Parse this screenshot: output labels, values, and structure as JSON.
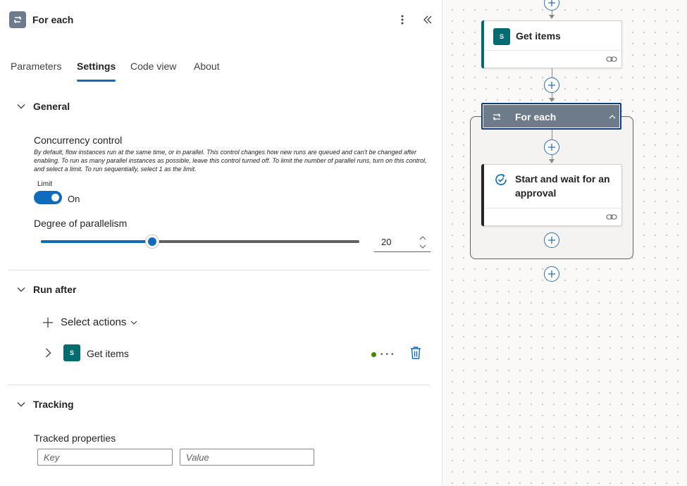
{
  "panel": {
    "title": "For each",
    "tabs": [
      "Parameters",
      "Settings",
      "Code view",
      "About"
    ],
    "active_tab": "Settings",
    "general": {
      "heading": "General",
      "concurrency_label": "Concurrency control",
      "concurrency_description": "By default, flow instances run at the same time, or in parallel. This control changes how new runs are queued and can't be changed after enabling. To run as many parallel instances as possible, leave this control turned off. To limit the number of parallel runs, turn on this control, and select a limit. To run sequentially, select 1 as the limit.",
      "limit_label": "Limit",
      "toggle_state": "On",
      "parallelism_label": "Degree of parallelism",
      "parallelism_value": "20",
      "slider_fraction": 0.35
    },
    "run_after": {
      "heading": "Run after",
      "select_actions_label": "Select actions",
      "action_label": "Get items",
      "action_sp_glyph": "S"
    },
    "tracking": {
      "heading": "Tracking",
      "tracked_properties_label": "Tracked properties",
      "key_placeholder": "Key",
      "value_placeholder": "Value"
    }
  },
  "canvas": {
    "get_items_title": "Get items",
    "get_items_sp_glyph": "S",
    "foreach_title": "For each",
    "approval_title": "Start and wait for an approval"
  },
  "colors": {
    "accent": "#0f6cbd",
    "sharepoint": "#036c70",
    "foreach_header": "#6e7b8b",
    "status_success": "#498205"
  }
}
